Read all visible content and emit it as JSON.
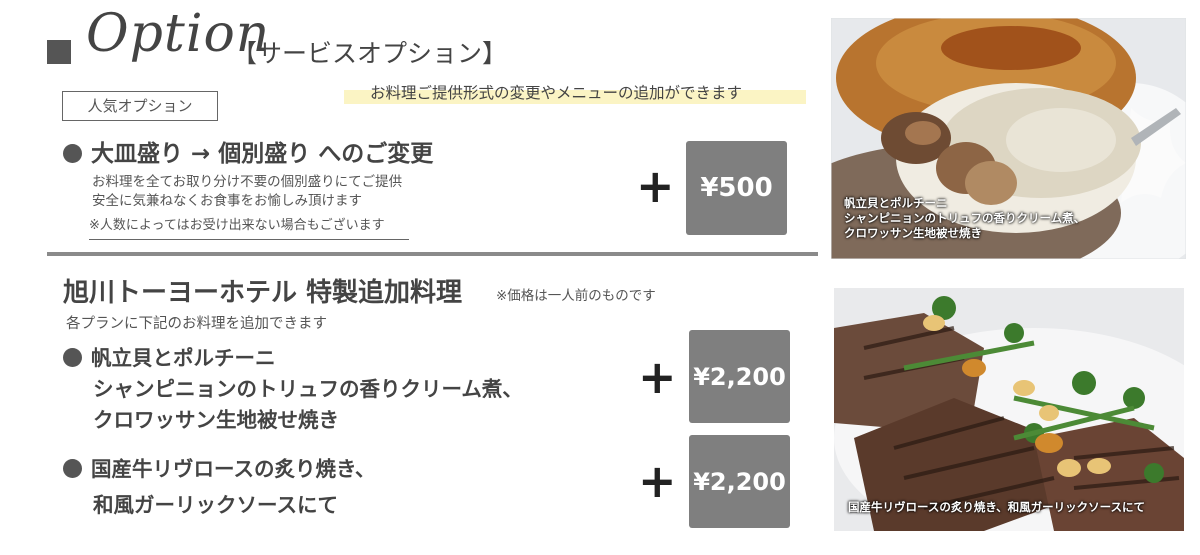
{
  "header": {
    "script_title": "Option",
    "jp_title": "【サービスオプション】",
    "subtitle": "お料理ご提供形式の変更やメニューの追加ができます"
  },
  "popular": {
    "badge": "人気オプション",
    "title": "大皿盛り → 個別盛り へのご変更",
    "desc_line1": "お料理を全てお取り分け不要の個別盛りにてご提供",
    "desc_line2": "安全に気兼ねなくお食事をお愉しみ頂けます",
    "note": "※人数によってはお受け出来ない場合もございます",
    "plus": "+",
    "price": "¥500"
  },
  "special": {
    "title": "旭川トーヨーホテル 特製追加料理",
    "title_note": "※価格は一人前のものです",
    "subtitle": "各プランに下記のお料理を追加できます",
    "items": [
      {
        "line1": "帆立貝とポルチーニ",
        "line2": "シャンピニョンのトリュフの香りクリーム煮、",
        "line3": "クロワッサン生地被せ焼き",
        "plus": "+",
        "price": "¥2,200"
      },
      {
        "line1": "国産牛リヴロースの炙り焼き、",
        "line2": "和風ガーリックソースにて",
        "plus": "+",
        "price": "¥2,200"
      }
    ]
  },
  "photos": {
    "top_caption": [
      "帆立貝とポルチーニ",
      "シャンピニョンのトリュフの香りクリーム煮、",
      "クロワッサン生地被せ焼き"
    ],
    "bottom_caption": "国産牛リヴロースの炙り焼き、和風ガーリックソースにて"
  },
  "colors": {
    "price_box": "#7f7f7f",
    "highlight": "#fbf4c4",
    "text": "#444444"
  }
}
